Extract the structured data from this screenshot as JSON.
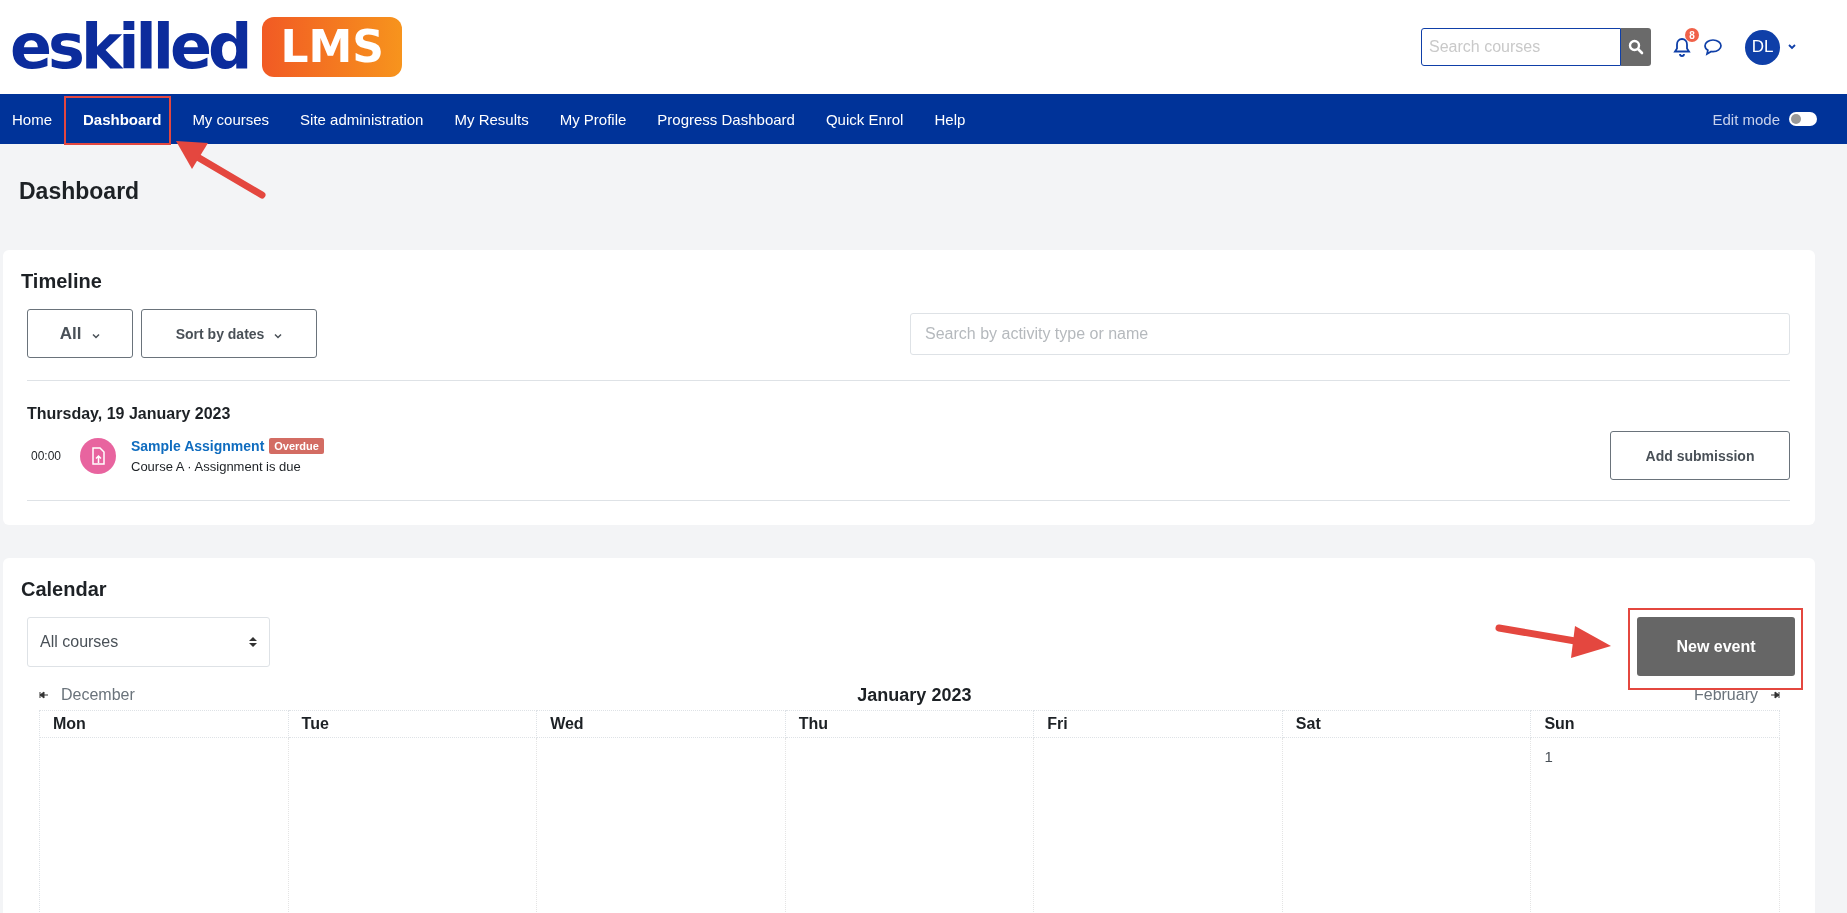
{
  "logo": {
    "text": "eskilled",
    "badge": "LMS"
  },
  "search": {
    "placeholder": "Search courses"
  },
  "notifications": {
    "count": "8"
  },
  "user": {
    "initials": "DL"
  },
  "nav": {
    "items": [
      {
        "label": "Home",
        "selected": false
      },
      {
        "label": "Dashboard",
        "selected": true
      },
      {
        "label": "My courses",
        "selected": false
      },
      {
        "label": "Site administration",
        "selected": false
      },
      {
        "label": "My Results",
        "selected": false
      },
      {
        "label": "My Profile",
        "selected": false
      },
      {
        "label": "Progress Dashboard",
        "selected": false
      },
      {
        "label": "Quick Enrol",
        "selected": false
      },
      {
        "label": "Help",
        "selected": false
      }
    ],
    "edit_mode": {
      "label": "Edit mode",
      "on": false
    }
  },
  "page_title": "Dashboard",
  "timeline": {
    "title": "Timeline",
    "filter": "All",
    "sort": "Sort by dates",
    "search": {
      "placeholder": "Search by activity type or name"
    },
    "groups": [
      {
        "date": "Thursday, 19 January 2023",
        "events": [
          {
            "time": "00:00",
            "name": "Sample Assignment",
            "badge": "Overdue",
            "details": "Course A · Assignment is due",
            "action": "Add submission"
          }
        ]
      }
    ]
  },
  "calendar": {
    "title": "Calendar",
    "course_filter": "All courses",
    "new_event": "New event",
    "prev": "December",
    "month": "January 2023",
    "next": "February",
    "days": [
      "Mon",
      "Tue",
      "Wed",
      "Thu",
      "Fri",
      "Sat",
      "Sun"
    ],
    "weeks": [
      {
        "sun": "1"
      }
    ]
  }
}
